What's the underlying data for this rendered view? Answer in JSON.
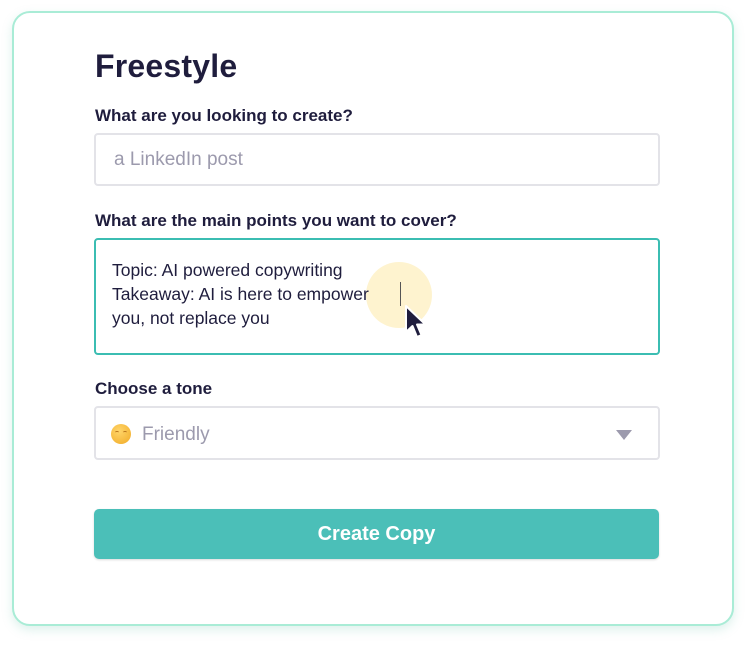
{
  "form": {
    "title": "Freestyle",
    "create": {
      "label": "What are you looking to create?",
      "placeholder": "a LinkedIn post"
    },
    "points": {
      "label": "What are the main points you want to cover?",
      "value": "Topic: AI powered copywriting\nTakeaway: AI is here to empower\nyou, not replace you"
    },
    "tone": {
      "label": "Choose a tone",
      "selected": "Friendly",
      "icon": "smiling-face-emoji-icon"
    },
    "submit_label": "Create Copy"
  },
  "colors": {
    "accent": "#4bbfb8",
    "focus_border": "#3bbdb2",
    "card_border": "#a9ecd6",
    "text": "#1f1d3d",
    "placeholder": "#9c9aad"
  }
}
